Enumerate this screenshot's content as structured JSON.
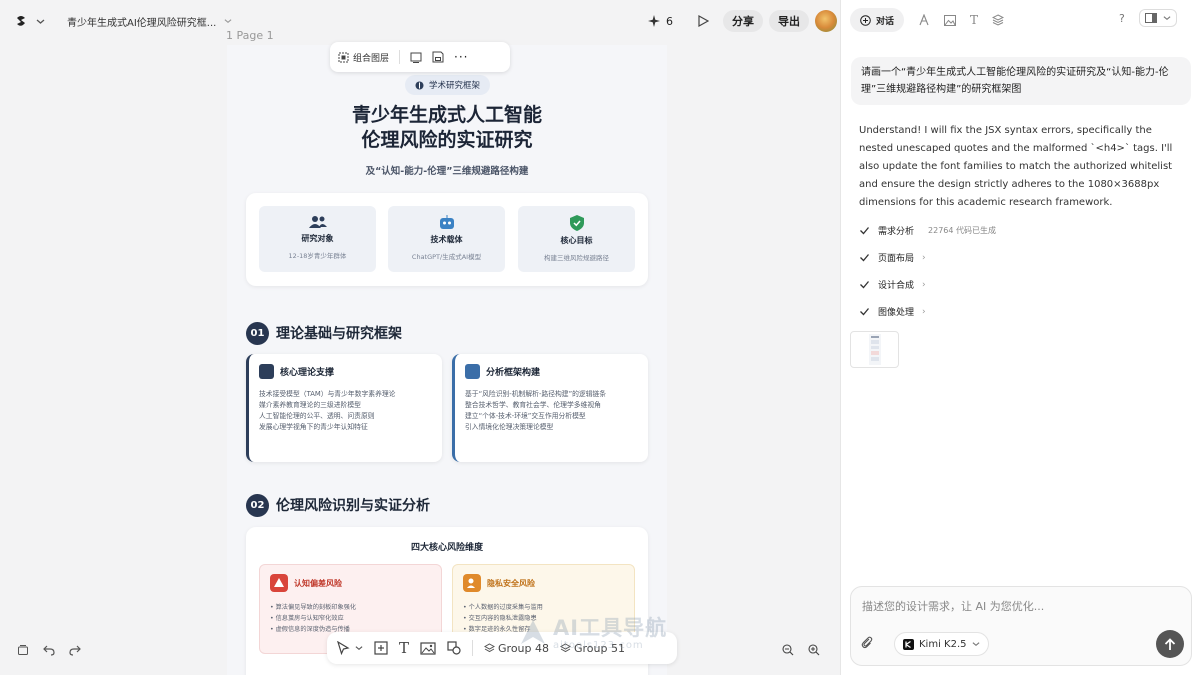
{
  "header": {
    "doc_title": "青少年生成式AI伦理风险研究框...",
    "page_label": "1 Page 1",
    "credits": "6",
    "share_label": "分享",
    "export_label": "导出"
  },
  "float_toolbar": {
    "group_label": "组合图层"
  },
  "design": {
    "badge": "学术研究框架",
    "title_line1": "青少年生成式人工智能",
    "title_line2": "伦理风险的实证研究",
    "subtitle": "及“认知-能力-伦理”三维规避路径构建",
    "cards": [
      {
        "title": "研究对象",
        "desc": "12-18岁青少年群体"
      },
      {
        "title": "技术载体",
        "desc": "ChatGPT/生成式AI模型"
      },
      {
        "title": "核心目标",
        "desc": "构建三维风险规避路径"
      }
    ],
    "section1": {
      "num": "01",
      "title": "理论基础与研究框架"
    },
    "theory_cards": [
      {
        "title": "核心理论支撑",
        "lines": [
          "技术接受模型（TAM）与青少年数字素养理论",
          "媒介素养教育理论的三级进阶模型",
          "人工智能伦理的公平、透明、问责原则",
          "发展心理学视角下的青少年认知特征"
        ]
      },
      {
        "title": "分析框架构建",
        "lines": [
          "基于“风险识别-机制解析-路径构建”的逻辑链条",
          "整合技术哲学、教育社会学、伦理学多维视角",
          "建立“个体-技术-环境”交互作用分析模型",
          "引入情境化伦理决策理论模型"
        ]
      }
    ],
    "section2": {
      "num": "02",
      "title": "伦理风险识别与实证分析"
    },
    "risk_box_title": "四大核心风险维度",
    "risks": [
      {
        "title": "认知偏差风险",
        "lines": [
          "• 算法偏见导致的刻板印象强化",
          "• 信息茧房与认知窄化效应",
          "• 虚假信息的深度伪造与传播"
        ]
      },
      {
        "title": "隐私安全风险",
        "lines": [
          "• 个人数据的过度采集与滥用",
          "• 交互内容的隐私泄露隐患",
          "• 数字足迹的永久性留存"
        ]
      }
    ]
  },
  "bottom_toolbar": {
    "group48": "Group 48",
    "group51": "Group 51"
  },
  "watermark": {
    "main": "AI工具导航",
    "sub": "aitools123.com"
  },
  "panel": {
    "tab_chat": "对话",
    "help": "?",
    "user_message": "请画一个“青少年生成式人工智能伦理风险的实证研究及“认知-能力-伦理”三维规避路径构建”的研究框架图",
    "ai_message": "Understand! I will fix the JSX syntax errors, specifically the nested unescaped quotes and the malformed `<h4>` tags. I'll also update the font families to match the authorized whitelist and ensure the design strictly adheres to the 1080×3688px dimensions for this academic research framework.",
    "steps": [
      {
        "label": "需求分析",
        "extra": "22764  代码已生成"
      },
      {
        "label": "页面布局",
        "extra": ""
      },
      {
        "label": "设计合成",
        "extra": ""
      },
      {
        "label": "图像处理",
        "extra": ""
      }
    ],
    "input_placeholder": "描述您的设计需求，让 AI 为您优化...",
    "model_name": "Kimi K2.5"
  }
}
